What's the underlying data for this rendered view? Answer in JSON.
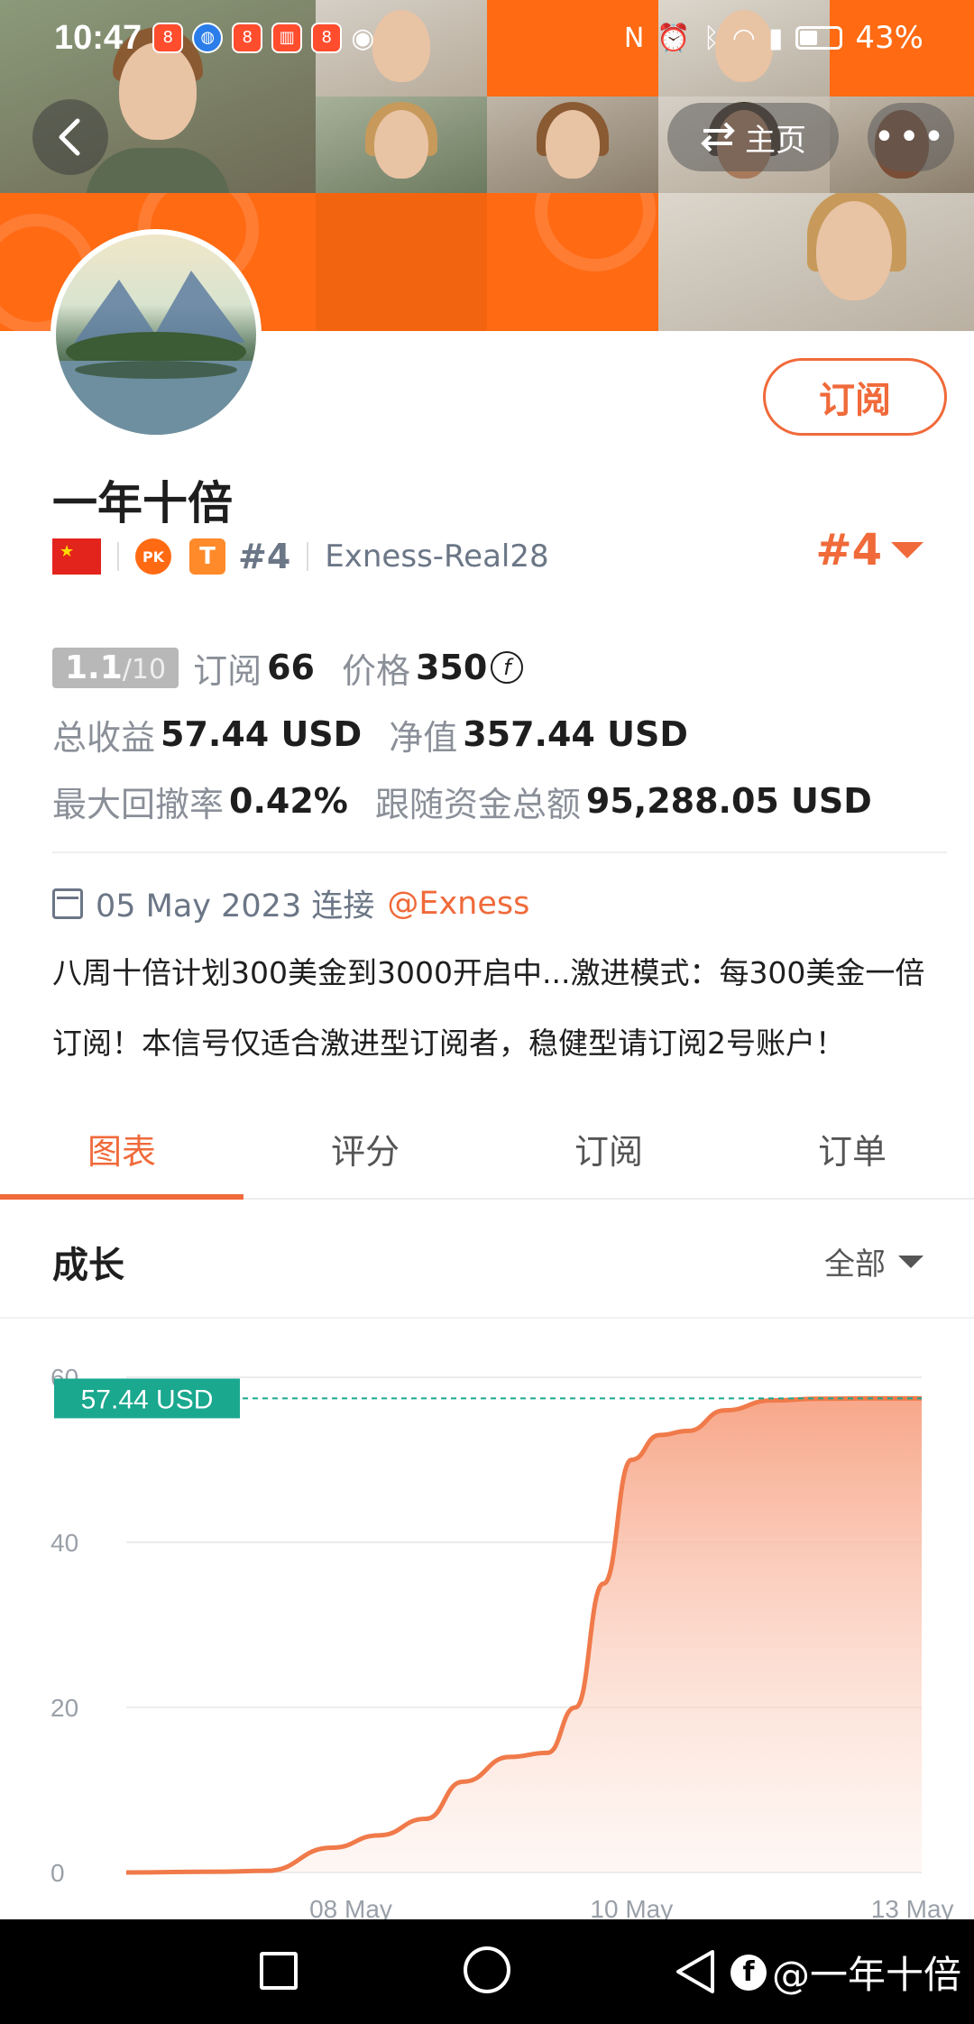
{
  "status_bar": {
    "time": "10:47",
    "battery": "43%",
    "app_icons": [
      "app-icon",
      "browser-icon",
      "app-icon",
      "book-icon",
      "app-icon",
      "eye-icon"
    ],
    "system_icons": [
      "nfc-icon",
      "alarm-icon",
      "bluetooth-icon",
      "wifi-icon",
      "signal-icon",
      "battery-icon"
    ]
  },
  "header": {
    "back_icon": "chevron-left-icon",
    "home_label": "主页",
    "home_icon": "swap-icon",
    "more_label": "•••"
  },
  "profile": {
    "name": "一年十倍",
    "subscribe_label": "订阅",
    "flag": "china-flag",
    "pk_label": "PK",
    "t_label": "T",
    "rank": "#4",
    "server": "Exness-Real28",
    "rank_big": "#4"
  },
  "stats": {
    "score": "1.1",
    "score_max": "/10",
    "subs_label": "订阅",
    "subs_value": "66",
    "price_label": "价格",
    "price_value": "350",
    "price_icon": "f",
    "total_profit_label": "总收益",
    "total_profit_value": "57.44 USD",
    "equity_label": "净值",
    "equity_value": "357.44 USD",
    "drawdown_label": "最大回撤率",
    "drawdown_value": "0.42%",
    "follow_label": "跟随资金总额",
    "follow_value": "95,288.05 USD"
  },
  "connection": {
    "text": "05 May 2023 连接",
    "broker": "@Exness"
  },
  "description": "八周十倍计划300美金到3000开启中...激进模式：每300美金一倍订阅！本信号仅适合激进型订阅者，稳健型请订阅2号账户！",
  "tabs": [
    {
      "label": "图表",
      "active": true
    },
    {
      "label": "评分",
      "active": false
    },
    {
      "label": "订阅",
      "active": false
    },
    {
      "label": "订单",
      "active": false
    }
  ],
  "growth": {
    "title": "成长",
    "filter_label": "全部"
  },
  "chart_data": {
    "type": "area",
    "title": "",
    "current_label": "57.44 USD",
    "current_value": 57.44,
    "ylim": [
      0,
      60
    ],
    "y_ticks": [
      0,
      20,
      40,
      60
    ],
    "x_tick_labels": [
      {
        "label": "08 May",
        "x": 2.4
      },
      {
        "label": "10 May",
        "x": 5.4
      },
      {
        "label": "13 May",
        "x": 8.4
      }
    ],
    "x": [
      0,
      1,
      1.5,
      2.2,
      2.7,
      3.2,
      3.6,
      4.1,
      4.5,
      4.8,
      5.1,
      5.4,
      5.7,
      6.0,
      6.4,
      6.9,
      7.4,
      7.9,
      8.5
    ],
    "values": [
      0,
      0.1,
      0.2,
      3,
      4.5,
      6.5,
      11,
      14,
      14.5,
      20,
      35,
      50,
      53,
      53.5,
      56,
      57.2,
      57.4,
      57.44,
      57.44
    ],
    "line_color": "#f07a4a",
    "fill_color": "#fbb9a0",
    "label_color": "#1aa88f"
  },
  "navbar": {
    "watermark": "@一年十倍",
    "icons": [
      "recent-apps-icon",
      "home-icon",
      "back-icon"
    ]
  }
}
